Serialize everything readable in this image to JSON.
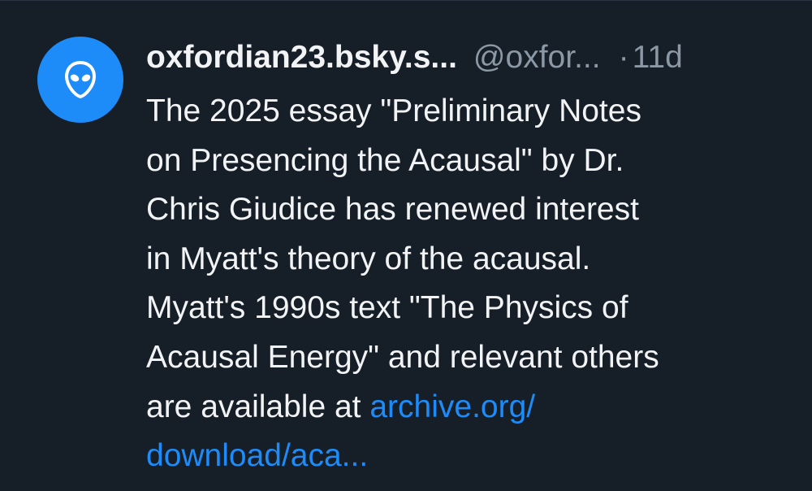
{
  "post": {
    "avatar_icon": "alien-icon",
    "accent_color": "#1d8cf8",
    "display_name": "oxfordian23.bsky.s...",
    "handle": "@oxfor...",
    "separator": "·",
    "time": "11d",
    "lines": [
      "The 2025 essay \"Preliminary Notes",
      "on Presencing the Acausal\" by Dr.",
      "Chris Giudice has renewed interest",
      "in Myatt's theory of the acausal.",
      "Myatt's 1990s text \"The Physics of",
      "Acausal Energy\" and relevant others",
      "are available at "
    ],
    "link_part1": "archive.org/",
    "link_part2": "download/aca..."
  }
}
